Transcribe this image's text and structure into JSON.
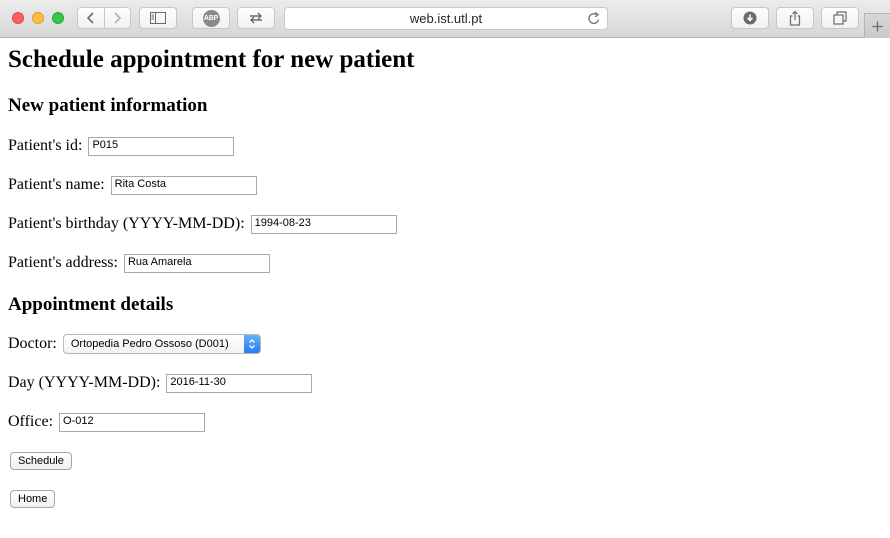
{
  "browser": {
    "url": "web.ist.utl.pt",
    "abp_label": "ABP"
  },
  "page": {
    "title": "Schedule appointment for new patient",
    "patient_section": {
      "heading": "New patient information",
      "fields": [
        {
          "label": "Patient's id:",
          "value": "P015"
        },
        {
          "label": "Patient's name:",
          "value": "Rita Costa"
        },
        {
          "label": "Patient's birthday (YYYY-MM-DD):",
          "value": "1994-08-23"
        },
        {
          "label": "Patient's address:",
          "value": "Rua Amarela"
        }
      ]
    },
    "appointment_section": {
      "heading": "Appointment details",
      "doctor_label": "Doctor:",
      "doctor_selected": "Ortopedia Pedro Ossoso (D001)",
      "day_label": "Day (YYYY-MM-DD):",
      "day_value": "2016-11-30",
      "office_label": "Office:",
      "office_value": "O-012"
    },
    "schedule_button": "Schedule",
    "home_button": "Home"
  },
  "colors": {
    "select_accent": "#1d7ef2",
    "close": "#fc605c",
    "minimize": "#fdbc40",
    "maximize": "#34c749"
  }
}
